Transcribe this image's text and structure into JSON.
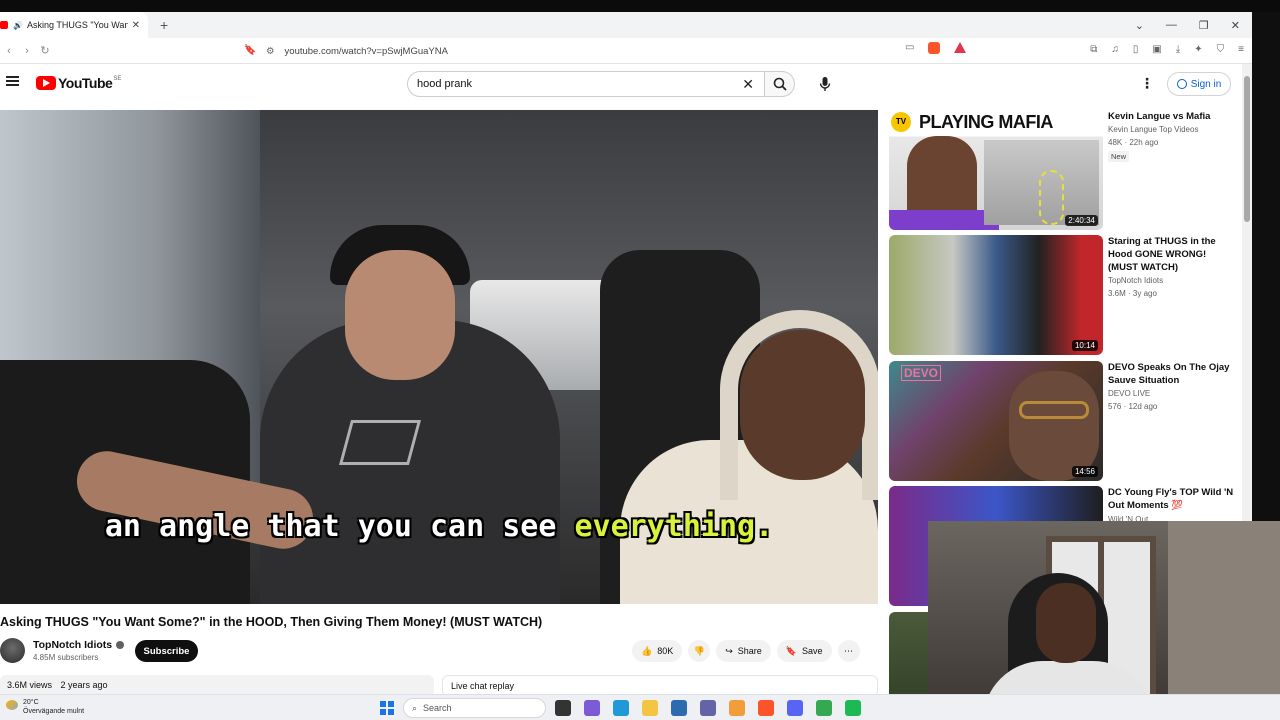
{
  "browser": {
    "tab_title": "Asking THUGS \"You Want So",
    "url": "youtube.com/watch?v=pSwjMGuaYNA"
  },
  "youtube": {
    "logo_text": "YouTube",
    "country": "SE",
    "search_value": "hood prank",
    "sign_in": "Sign in"
  },
  "video": {
    "caption_before": "an angle that you can see ",
    "caption_highlight": "everything.",
    "title": "Asking THUGS \"You Want Some?\" in the HOOD, Then Giving Them Money! (MUST WATCH)",
    "channel": "TopNotch Idiots",
    "subscribers": "4.85M subscribers",
    "subscribe_label": "Subscribe",
    "likes": "80K",
    "share_label": "Share",
    "save_label": "Save",
    "views": "3.6M views",
    "age": "2 years ago",
    "chat_label": "Live chat replay"
  },
  "recommendations": [
    {
      "title": "Kevin Langue vs Mafia",
      "channel": "Kevin Langue Top Videos",
      "meta": "48K · 22h ago",
      "badge": "New",
      "duration": "2:40:34",
      "thumb_text": "PLAYING MAFIA",
      "thumb_badge": "TV"
    },
    {
      "title": "Staring at THUGS in the Hood GONE WRONG! (MUST WATCH)",
      "channel": "TopNotch Idiots",
      "meta": "3.6M · 3y ago",
      "duration": "10:14"
    },
    {
      "title": "DEVO Speaks On The Ojay Sauve Situation",
      "channel": "DEVO LIVE",
      "meta": "576 · 12d ago",
      "duration": "14:56",
      "thumb_text": "DEVO"
    },
    {
      "title": "DC Young Fly's TOP Wild 'N Out Moments 💯",
      "channel": "Wild 'N Out",
      "meta": ""
    }
  ],
  "taskbar": {
    "temp": "20°C",
    "weather": "Övervägande mulnt",
    "search_placeholder": "Search"
  },
  "colors": {
    "youtube_red": "#ff0000",
    "caption_highlight": "#d9f23a",
    "link_blue": "#065fd4"
  }
}
